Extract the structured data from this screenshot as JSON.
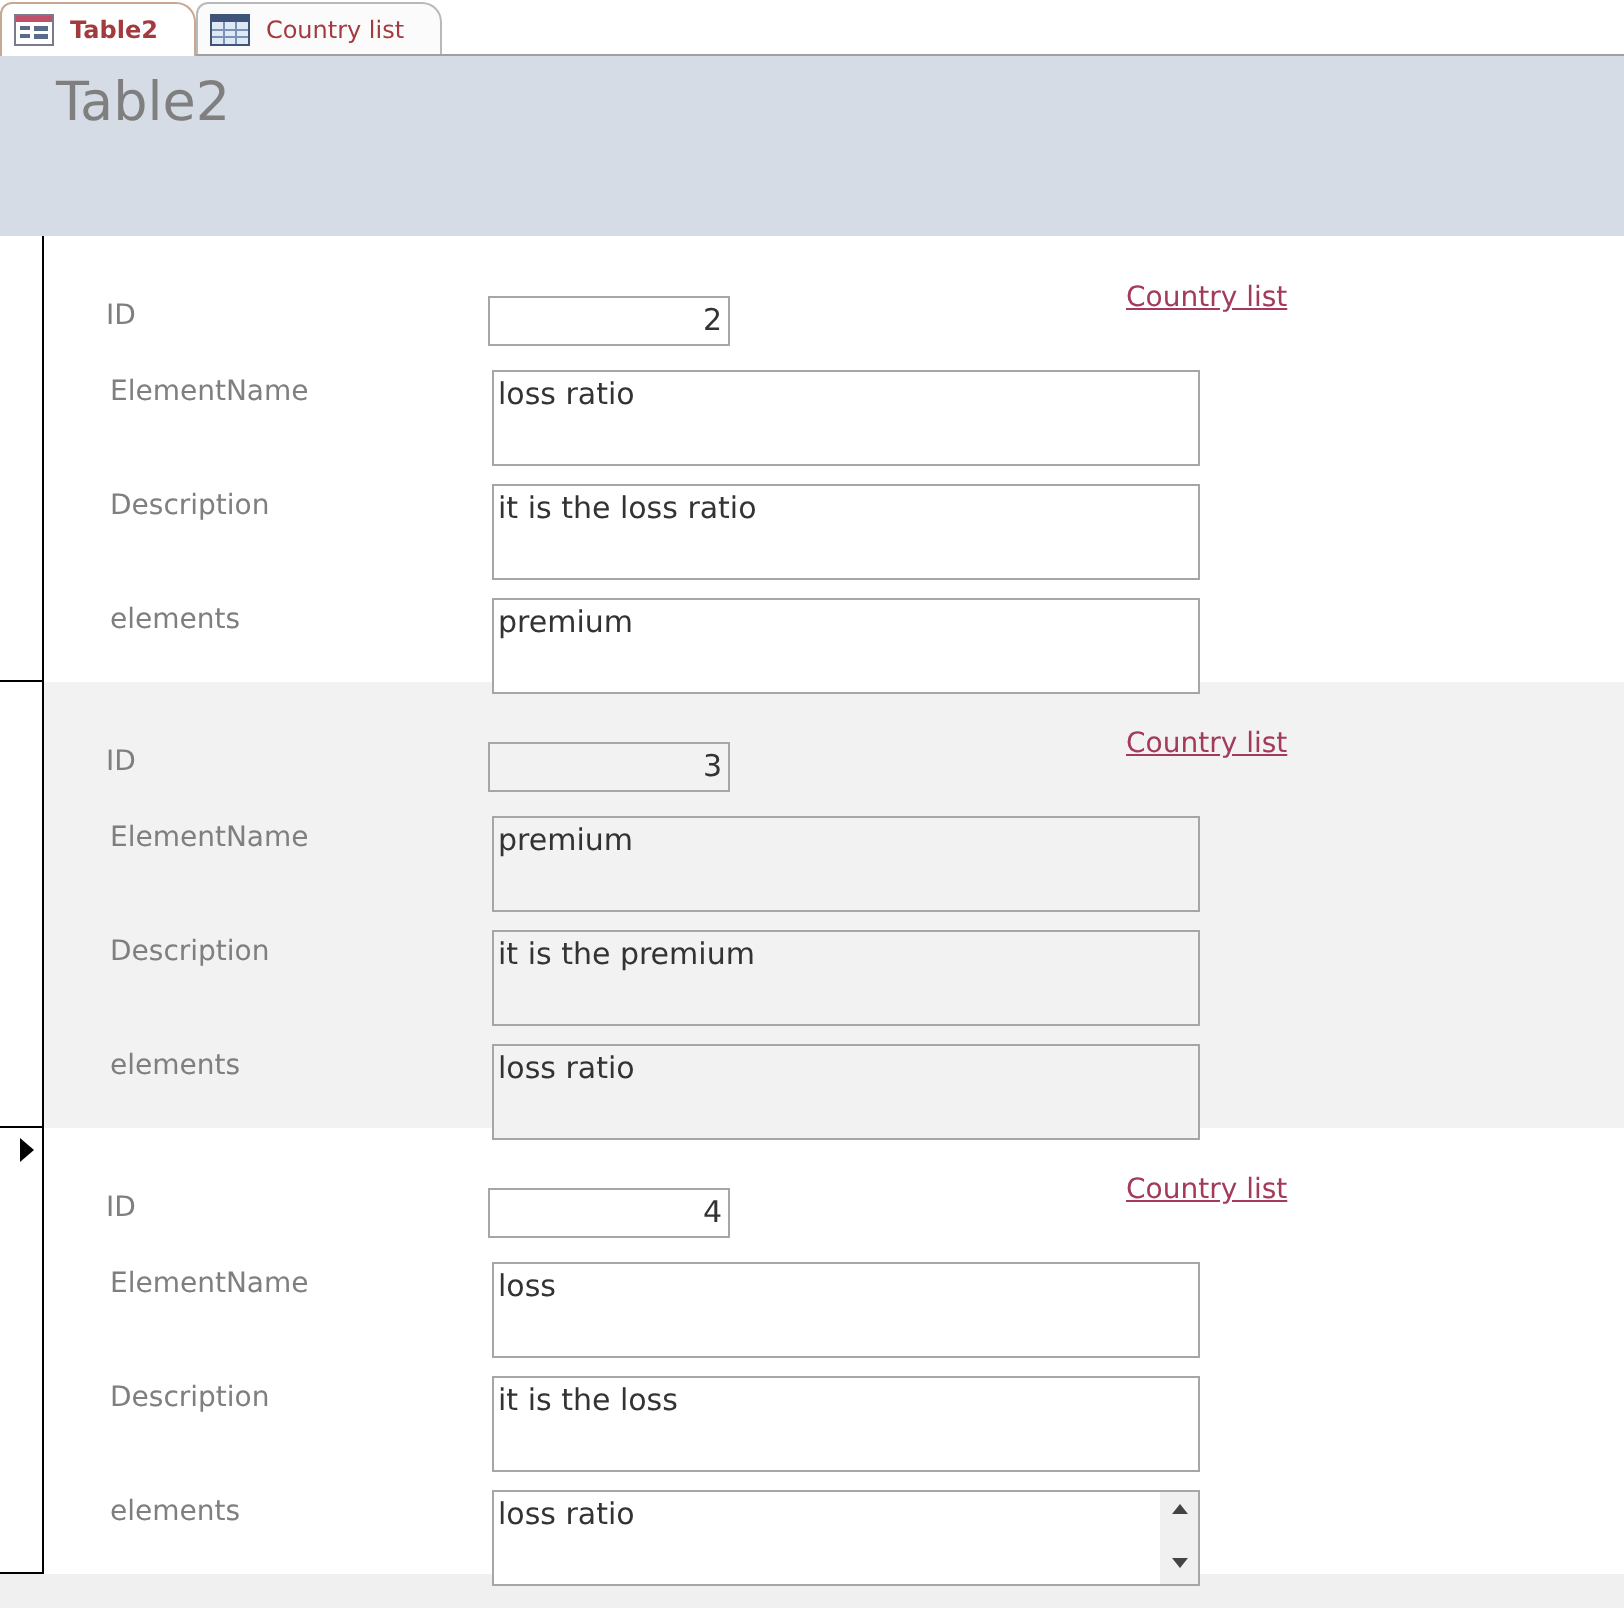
{
  "tabs": [
    {
      "label": "Table2",
      "kind": "form",
      "selected": true
    },
    {
      "label": "Country list",
      "kind": "table",
      "selected": false
    }
  ],
  "form_title": "Table2",
  "records": [
    {
      "current": false,
      "link": "Country list",
      "fields": [
        {
          "label": "ID",
          "value": "2",
          "kind": "number"
        },
        {
          "label": "ElementName",
          "value": "loss ratio",
          "kind": "text"
        },
        {
          "label": "Description",
          "value": "it is the loss ratio",
          "kind": "text"
        },
        {
          "label": "elements",
          "value": "premium",
          "kind": "text"
        }
      ]
    },
    {
      "current": false,
      "link": "Country list",
      "fields": [
        {
          "label": "ID",
          "value": "3",
          "kind": "number"
        },
        {
          "label": "ElementName",
          "value": "premium",
          "kind": "text"
        },
        {
          "label": "Description",
          "value": "it is the premium",
          "kind": "text"
        },
        {
          "label": "elements",
          "value": "loss ratio",
          "kind": "text"
        }
      ]
    },
    {
      "current": true,
      "link": "Country list",
      "fields": [
        {
          "label": "ID",
          "value": "4",
          "kind": "number"
        },
        {
          "label": "ElementName",
          "value": "loss",
          "kind": "text"
        },
        {
          "label": "Description",
          "value": "it is the loss",
          "kind": "text"
        },
        {
          "label": "elements",
          "value": "loss ratio",
          "kind": "text",
          "scrollbar": true
        }
      ]
    }
  ]
}
